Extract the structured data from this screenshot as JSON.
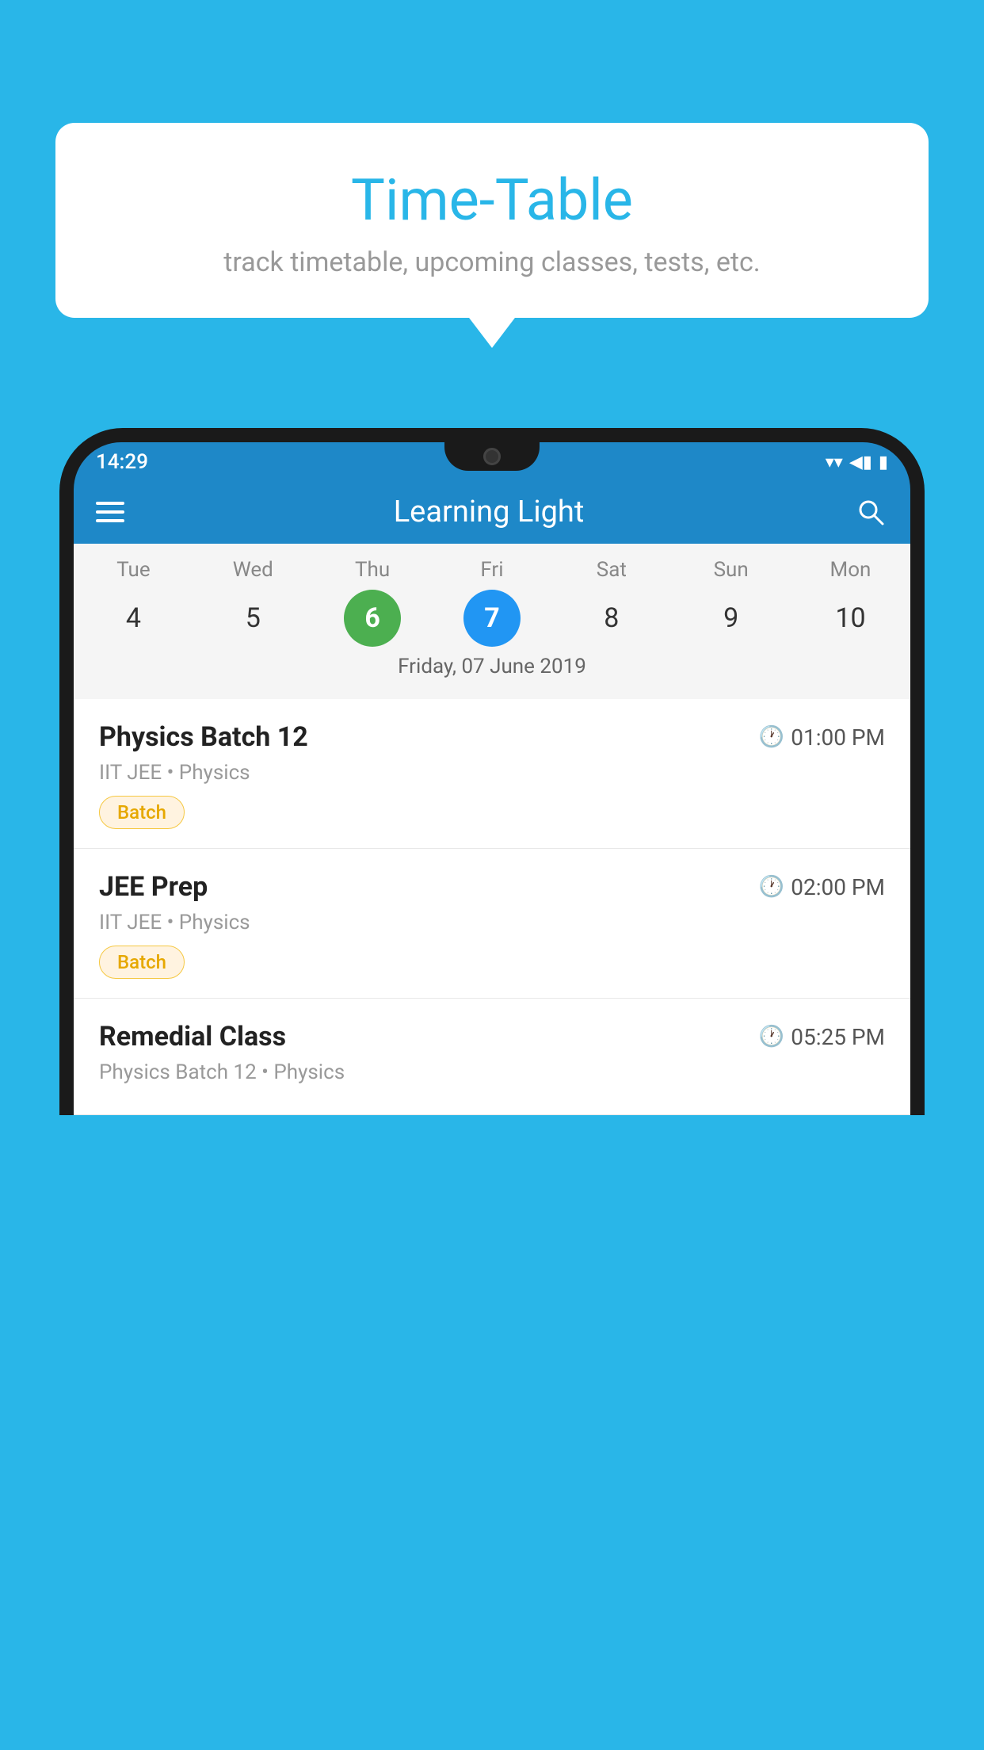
{
  "background_color": "#29B6E8",
  "speech_bubble": {
    "title": "Time-Table",
    "subtitle": "track timetable, upcoming classes, tests, etc."
  },
  "phone": {
    "status_bar": {
      "time": "14:29",
      "signal_icon": "▲",
      "wifi_icon": "wifi"
    },
    "app_bar": {
      "title": "Learning Light",
      "menu_icon": "hamburger",
      "search_icon": "search"
    },
    "calendar": {
      "days": [
        "Tue",
        "Wed",
        "Thu",
        "Fri",
        "Sat",
        "Sun",
        "Mon"
      ],
      "numbers": [
        4,
        5,
        6,
        7,
        8,
        9,
        10
      ],
      "today_index": 2,
      "selected_index": 3,
      "selected_label": "Friday, 07 June 2019"
    },
    "schedule": [
      {
        "title": "Physics Batch 12",
        "time": "01:00 PM",
        "subtitle": "IIT JEE • Physics",
        "badge": "Batch"
      },
      {
        "title": "JEE Prep",
        "time": "02:00 PM",
        "subtitle": "IIT JEE • Physics",
        "badge": "Batch"
      },
      {
        "title": "Remedial Class",
        "time": "05:25 PM",
        "subtitle": "Physics Batch 12 • Physics",
        "badge": null
      }
    ]
  }
}
